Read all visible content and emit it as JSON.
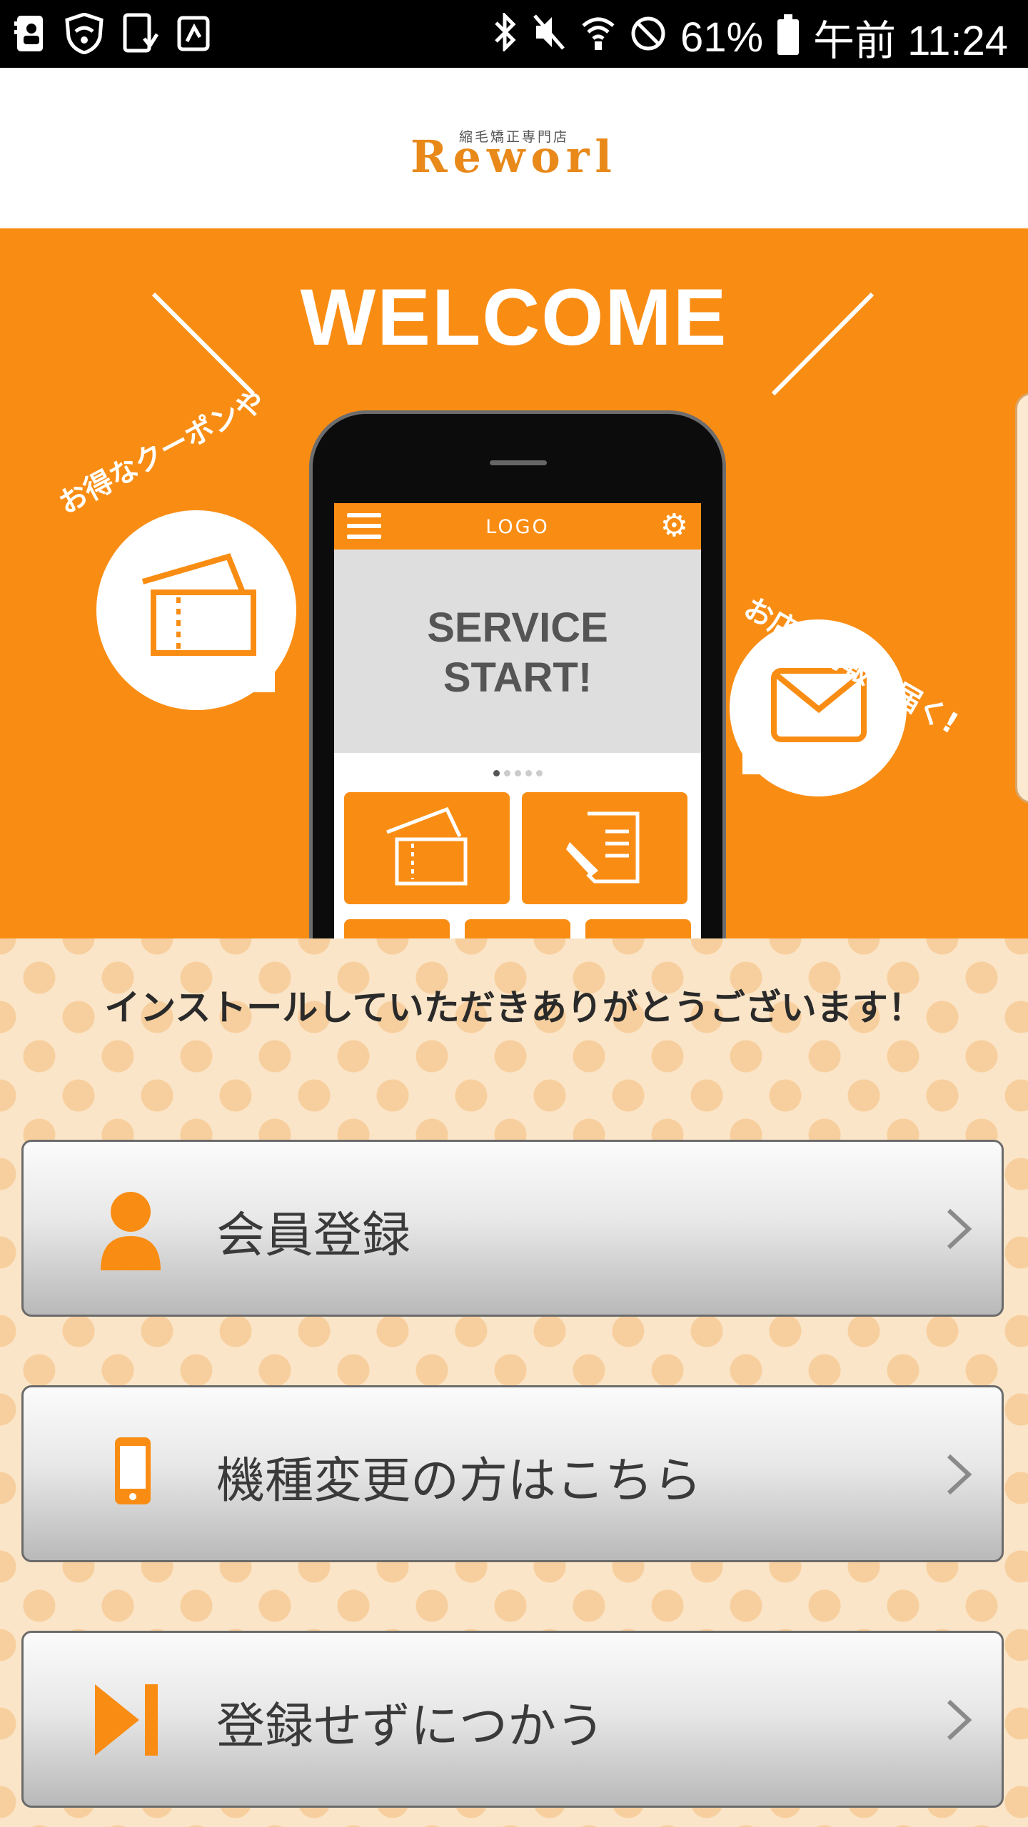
{
  "status_bar": {
    "battery": "61%",
    "time": "午前 11:24",
    "icons": [
      "sim-icon",
      "wifi-shield-icon",
      "download-icon",
      "nfc-icon",
      "bluetooth-icon",
      "mute-icon",
      "wifi-icon",
      "block-icon",
      "battery-icon"
    ]
  },
  "header": {
    "logo_sub": "縮毛矯正専門店",
    "logo_main": "Reworl"
  },
  "hero": {
    "title": "WELCOME",
    "left_bubble_text": "お得なクーポンや",
    "right_bubble_text": "お店の情報が届く!",
    "phone_screen": {
      "logo": "LOGO",
      "banner_line1": "SERVICE",
      "banner_line2": "START!"
    }
  },
  "thanks_text": "インストールしていただきありがとうございます！",
  "buttons": [
    {
      "label": "会員登録",
      "icon": "person-icon"
    },
    {
      "label": "機種変更の方はこちら",
      "icon": "smartphone-icon"
    },
    {
      "label": "登録せずにつかう",
      "icon": "skip-icon"
    }
  ],
  "colors": {
    "accent": "#f98d14",
    "background_dots": "#fbe5c8"
  }
}
